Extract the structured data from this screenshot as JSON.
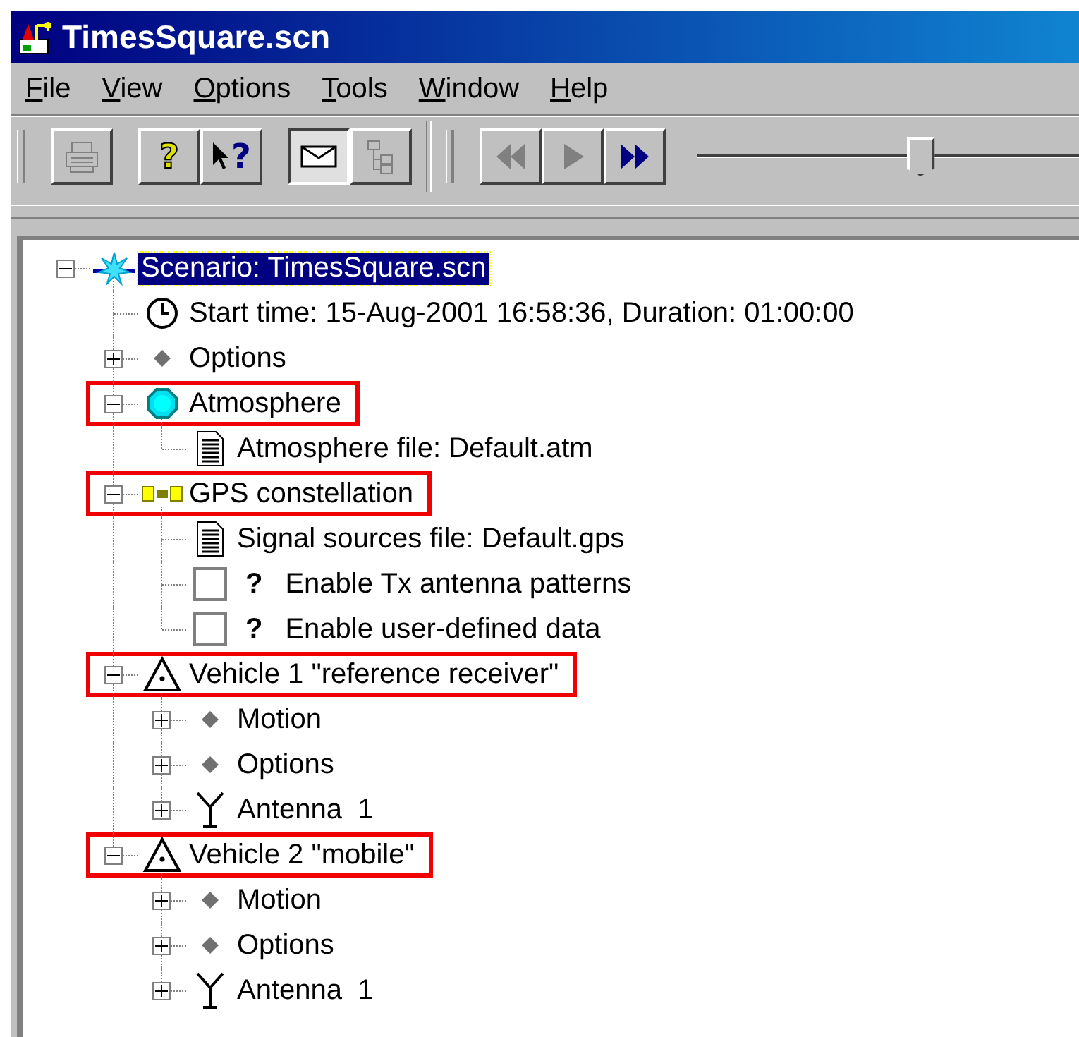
{
  "window": {
    "title": "TimesSquare.scn"
  },
  "menu": [
    {
      "label": "File"
    },
    {
      "label": "View"
    },
    {
      "label": "Options"
    },
    {
      "label": "Tools"
    },
    {
      "label": "Window"
    },
    {
      "label": "Help"
    }
  ],
  "toolbar": {
    "groups": [
      [
        {
          "kind": "print",
          "disabled": true,
          "pressed": false
        }
      ],
      [
        {
          "kind": "help",
          "glyph": "?",
          "disabled": false,
          "pressed": false
        },
        {
          "kind": "context-help",
          "glyph": "?",
          "disabled": false,
          "pressed": false
        }
      ],
      [
        {
          "kind": "mail",
          "disabled": false,
          "pressed": true
        },
        {
          "kind": "tree",
          "disabled": true,
          "pressed": false
        }
      ],
      [
        {
          "kind": "rewind",
          "disabled": true,
          "pressed": false
        },
        {
          "kind": "play",
          "disabled": true,
          "pressed": false
        },
        {
          "kind": "fast-forward",
          "disabled": false,
          "pressed": false
        }
      ]
    ],
    "slider": {
      "level": 0.51
    }
  },
  "tree": [
    {
      "kind": "scenario",
      "label": "Scenario: TimesSquare.scn",
      "selected": true,
      "highlighted": false,
      "expanded": true,
      "children": [
        {
          "kind": "clock",
          "label": "Start time: 15-Aug-2001 16:58:36, Duration: 01:00:00",
          "selected": false,
          "highlighted": false
        },
        {
          "kind": "item",
          "label": "Options",
          "selected": false,
          "highlighted": false,
          "expanded": false
        },
        {
          "kind": "atmosphere",
          "label": "Atmosphere",
          "selected": false,
          "highlighted": true,
          "expanded": true,
          "children": [
            {
              "kind": "file",
              "label": "Atmosphere file: Default.atm",
              "selected": false,
              "highlighted": false
            }
          ]
        },
        {
          "kind": "constellation",
          "label": "GPS constellation",
          "selected": false,
          "highlighted": true,
          "expanded": true,
          "children": [
            {
              "kind": "file",
              "label": "Signal sources file: Default.gps",
              "selected": false,
              "highlighted": false
            },
            {
              "kind": "checkbox",
              "marker": "?",
              "label": "Enable Tx antenna patterns",
              "checked": false,
              "selected": false,
              "highlighted": false
            },
            {
              "kind": "checkbox",
              "marker": "?",
              "label": "Enable user-defined data",
              "checked": false,
              "selected": false,
              "highlighted": false
            }
          ]
        },
        {
          "kind": "vehicle",
          "label": "Vehicle 1 \"reference receiver\"",
          "selected": false,
          "highlighted": true,
          "expanded": true,
          "children": [
            {
              "kind": "item",
              "label": "Motion",
              "selected": false,
              "highlighted": false,
              "expanded": false
            },
            {
              "kind": "item",
              "label": "Options",
              "selected": false,
              "highlighted": false,
              "expanded": false
            },
            {
              "kind": "antenna",
              "label": "Antenna  1",
              "selected": false,
              "highlighted": false,
              "expanded": false
            }
          ]
        },
        {
          "kind": "vehicle",
          "label": "Vehicle 2 \"mobile\"",
          "selected": false,
          "highlighted": true,
          "expanded": true,
          "children": [
            {
              "kind": "item",
              "label": "Motion",
              "selected": false,
              "highlighted": false,
              "expanded": false
            },
            {
              "kind": "item",
              "label": "Options",
              "selected": false,
              "highlighted": false,
              "expanded": false
            },
            {
              "kind": "antenna",
              "label": "Antenna  1",
              "selected": false,
              "highlighted": false,
              "expanded": false
            }
          ]
        }
      ]
    }
  ]
}
